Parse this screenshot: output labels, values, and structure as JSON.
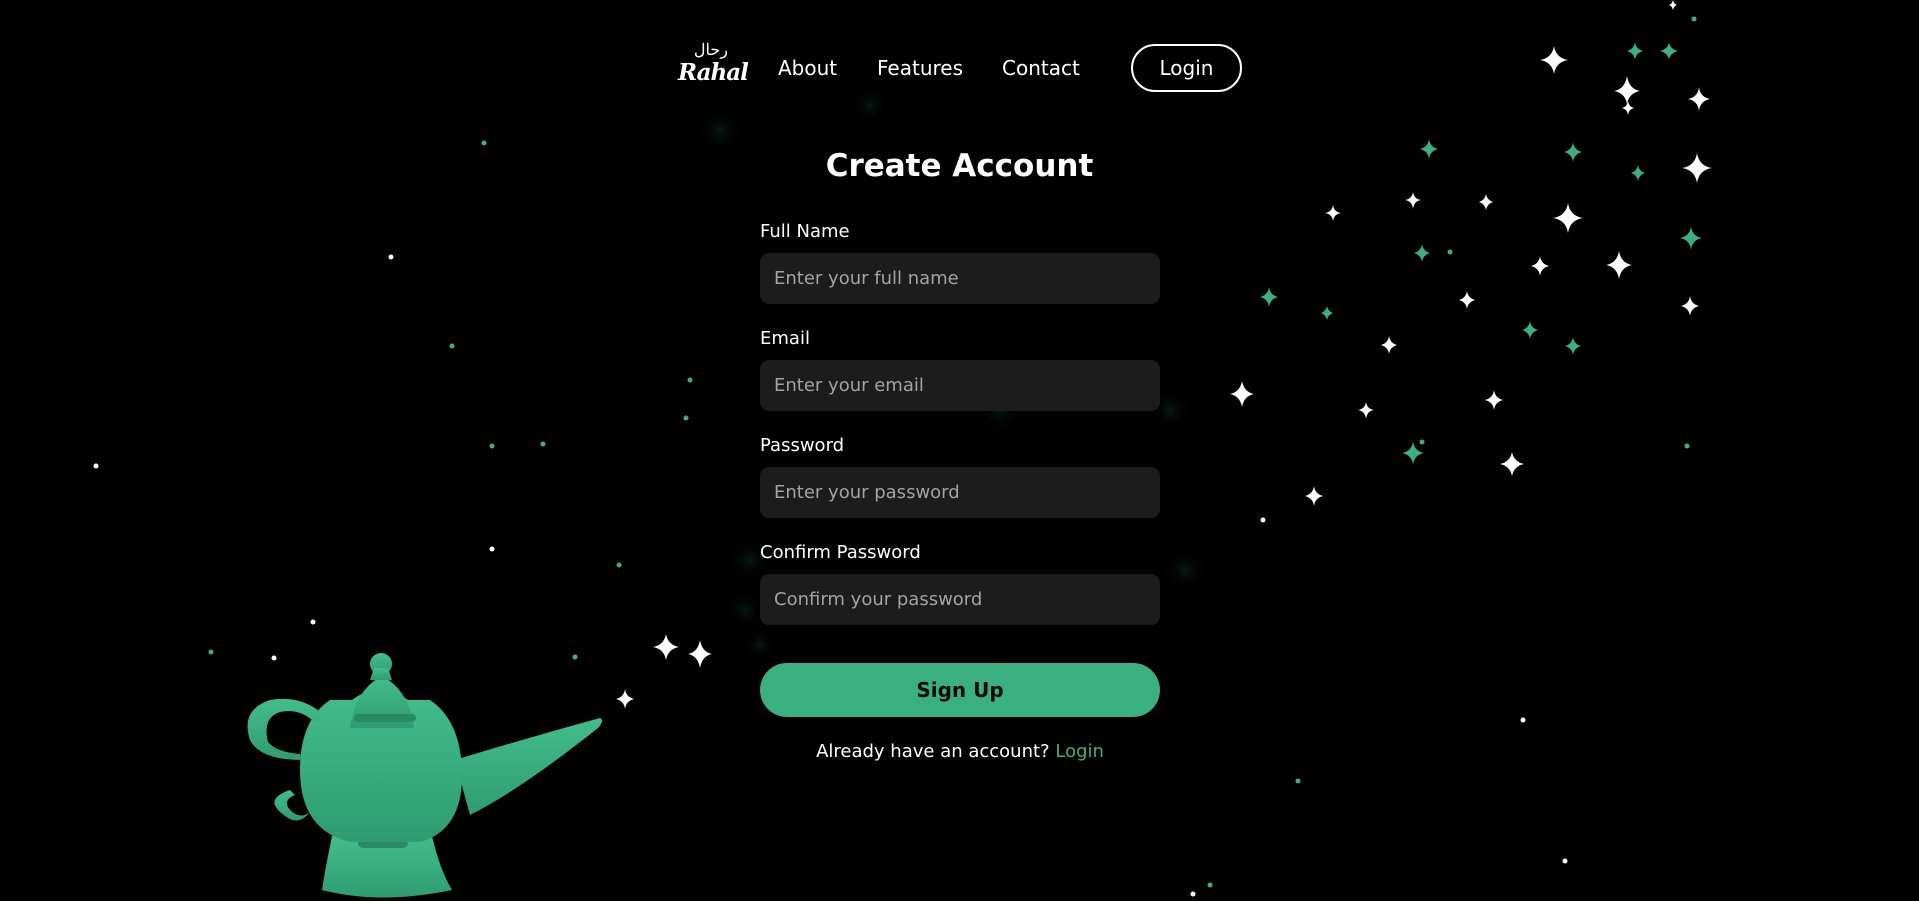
{
  "brand": {
    "logo_arabic": "رحال",
    "logo_latin": "Rahal",
    "accent_color": "#3aaf82"
  },
  "nav": {
    "links": [
      {
        "label": "About"
      },
      {
        "label": "Features"
      },
      {
        "label": "Contact"
      }
    ],
    "login_label": "Login"
  },
  "form": {
    "title": "Create Account",
    "fields": [
      {
        "label": "Full Name",
        "placeholder": "Enter your full name",
        "type": "text"
      },
      {
        "label": "Email",
        "placeholder": "Enter your email",
        "type": "email"
      },
      {
        "label": "Password",
        "placeholder": "Enter your password",
        "type": "password"
      },
      {
        "label": "Confirm Password",
        "placeholder": "Confirm your password",
        "type": "password"
      }
    ],
    "submit_label": "Sign Up",
    "login_prompt": "Already have an account?",
    "login_link": "Login"
  },
  "decorations": {
    "lamp_icon": "magic-lamp-icon",
    "sparkle_icon": "four-point-star-icon"
  }
}
